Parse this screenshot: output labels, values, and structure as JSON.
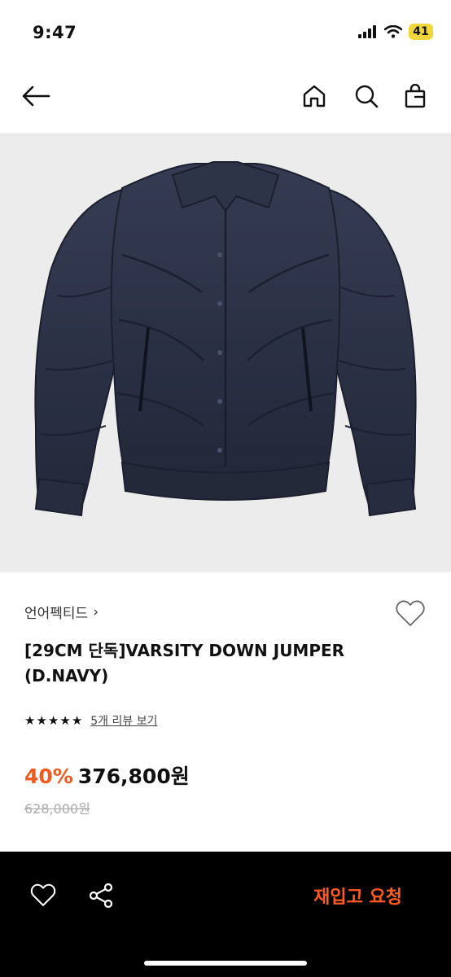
{
  "status_bar": {
    "time": "9:47",
    "battery": "41"
  },
  "nav": {
    "back_icon": "arrow-left-icon",
    "home_icon": "home-icon",
    "search_icon": "search-icon",
    "bag_icon": "shopping-bag-icon"
  },
  "product": {
    "image_alt": "navy down jumper",
    "brand": "언어펙티드",
    "brand_chevron": "›",
    "title": "[29CM 단독]VARSITY DOWN JUMPER (D.NAVY)",
    "rating": 5,
    "stars": [
      "★",
      "★",
      "★",
      "★",
      "★"
    ],
    "review_link": "5개 리뷰 보기",
    "discount": "40%",
    "price": "376,800원",
    "original_price": "628,000원"
  },
  "bottom_bar": {
    "like_icon": "heart-icon",
    "share_icon": "share-icon",
    "restock_label": "재입고 요청"
  },
  "colors": {
    "accent": "#f05a1e",
    "bottom_bar_bg": "#000000",
    "image_bg": "#ececec",
    "jacket": "#2b3043"
  }
}
